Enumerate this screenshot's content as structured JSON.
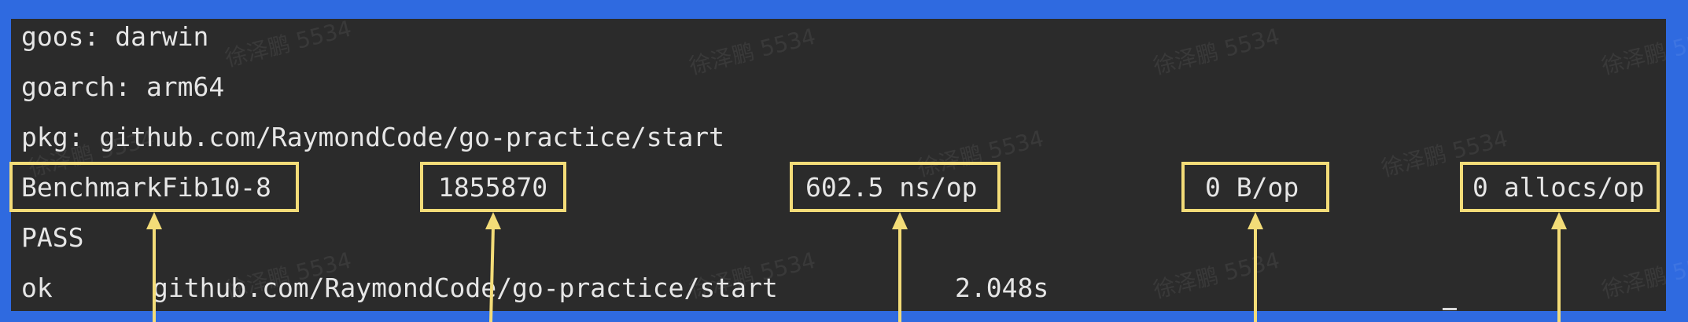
{
  "terminal": {
    "lines": {
      "goos": "goos: darwin",
      "goarch": "goarch: arm64",
      "pkg": "pkg: github.com/RaymondCode/go-practice/start",
      "pass": "PASS"
    },
    "benchmark": {
      "name": "BenchmarkFib10-8",
      "iterations": "1855870",
      "ns_per_op": "602.5 ns/op",
      "bytes_per_op": "0 B/op",
      "allocs_per_op": "0 allocs/op"
    },
    "result": {
      "status": "ok",
      "package": "github.com/RaymondCode/go-practice/start",
      "time": "2.048s"
    }
  },
  "watermark": {
    "text": "徐泽鹏 5534"
  },
  "colors": {
    "background": "#2f6ae0",
    "terminal": "#2b2b2b",
    "text": "#e6e6e6",
    "highlight": "#f3dc78"
  }
}
